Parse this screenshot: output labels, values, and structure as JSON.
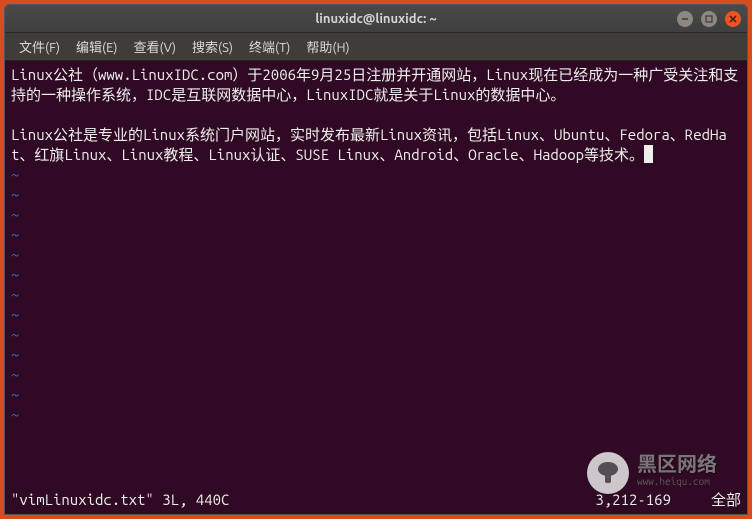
{
  "window": {
    "title": "linuxidc@linuxidc: ~"
  },
  "menu": {
    "file": "文件(F)",
    "edit": "编辑(E)",
    "view": "查看(V)",
    "search": "搜索(S)",
    "terminal": "终端(T)",
    "help": "帮助(H)"
  },
  "content": {
    "para1": "Linux公社（www.LinuxIDC.com）于2006年9月25日注册并开通网站，Linux现在已经成为一种广受关注和支持的一种操作系统，IDC是互联网数据中心，LinuxIDC就是关于Linux的数据中心。",
    "para2": "Linux公社是专业的Linux系统门户网站，实时发布最新Linux资讯，包括Linux、Ubuntu、Fedora、RedHat、红旗Linux、Linux教程、Linux认证、SUSE Linux、Android、Oracle、Hadoop等技术。"
  },
  "status": {
    "filename": "\"vimLinuxidc.txt\" 3L, 440C",
    "position": "3,212-169",
    "scroll": "全部"
  },
  "watermark": {
    "text": "黑区网络",
    "sub": "www.heiqu.com"
  }
}
